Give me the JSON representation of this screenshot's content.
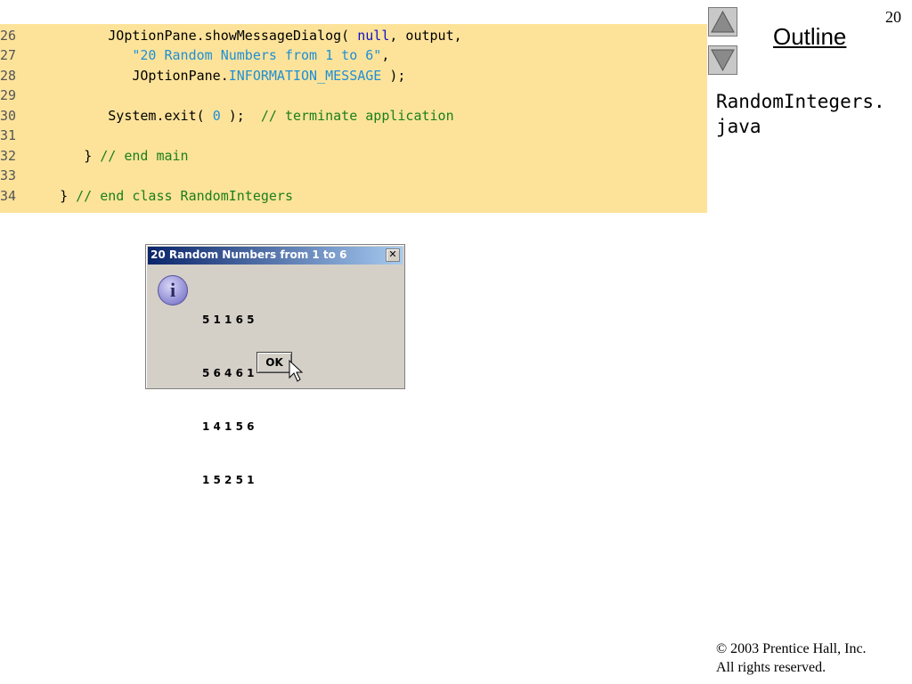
{
  "slide": {
    "page_number": "20",
    "outline_label": "Outline",
    "filename_line1": "RandomIntegers.",
    "filename_line2": "java",
    "copyright_symbol": "©",
    "copyright_line1": " 2003 Prentice Hall, Inc.",
    "copyright_line2": "All rights reserved."
  },
  "code": {
    "l26": {
      "num": "26",
      "indent": "         ",
      "a": "JOptionPane.showMessageDialog( ",
      "b": "null",
      "c": ", output,"
    },
    "l27": {
      "num": "27",
      "indent": "            ",
      "a": "\"20 Random Numbers from 1 to 6\"",
      "b": ","
    },
    "l28": {
      "num": "28",
      "indent": "            ",
      "a": "JOptionPane.",
      "b": "INFORMATION_MESSAGE",
      "c": " );"
    },
    "l29": {
      "num": "29"
    },
    "l30": {
      "num": "30",
      "indent": "         ",
      "a": "System.exit( ",
      "b": "0",
      "c": " );  ",
      "d": "// terminate application"
    },
    "l31": {
      "num": "31"
    },
    "l32": {
      "num": "32",
      "indent": "      ",
      "a": "} ",
      "b": "// end main"
    },
    "l33": {
      "num": "33"
    },
    "l34": {
      "num": "34",
      "indent": "   ",
      "a": "} ",
      "b": "// end class RandomIntegers"
    }
  },
  "dialog": {
    "title": "20 Random Numbers from 1 to 6",
    "close_glyph": "✕",
    "icon_glyph": "i",
    "rows": [
      "5 1 1 6 5",
      "5 6 4 6 1",
      "1 4 1 5 6",
      "1 5 2 5 1"
    ],
    "ok_label": "OK"
  }
}
